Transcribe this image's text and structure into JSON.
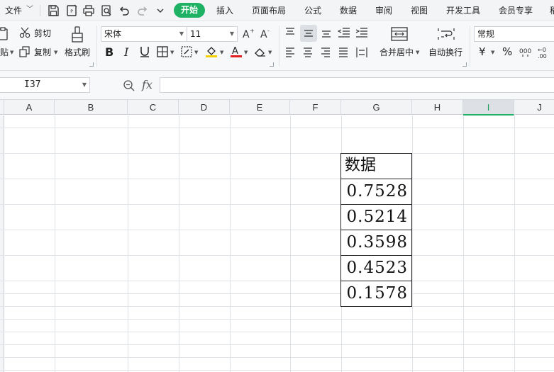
{
  "menubar": {
    "file_label": "文件",
    "tabs": [
      "开始",
      "插入",
      "页面布局",
      "公式",
      "数据",
      "审阅",
      "视图",
      "开发工具",
      "会员专享",
      "稻"
    ]
  },
  "ribbon": {
    "cut_label": "剪切",
    "paste_label": "贴",
    "copy_label": "复制",
    "format_painter_label": "格式刷",
    "font_name": "宋体",
    "font_size": "11",
    "merge_center_label": "合并居中",
    "wrap_text_label": "自动换行",
    "number_format": "常规",
    "currency_symbol": "¥",
    "percent_symbol": "%"
  },
  "formula": {
    "name_box": "I37",
    "fx_label": "fx",
    "content": ""
  },
  "columns": [
    "A",
    "B",
    "C",
    "D",
    "E",
    "F",
    "G",
    "H",
    "I",
    "J"
  ],
  "selected_column": "I",
  "table": {
    "header": "数据",
    "values": [
      "0.7528",
      "0.5214",
      "0.3598",
      "0.4523",
      "0.1578"
    ]
  },
  "colors": {
    "accent_green": "#1fb264",
    "grid_line": "#dfe2e7",
    "header_bg": "#f3f4f6"
  }
}
